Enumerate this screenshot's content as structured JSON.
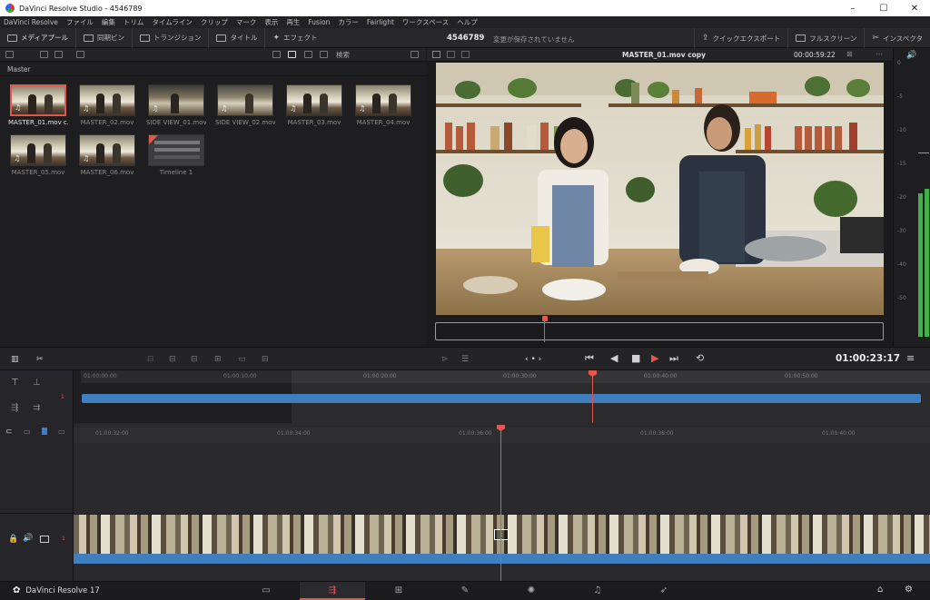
{
  "window": {
    "title": "DaVinci Resolve Studio - 4546789",
    "controls": [
      "–",
      "☐",
      "✕"
    ]
  },
  "menu": [
    "DaVinci Resolve",
    "ファイル",
    "編集",
    "トリム",
    "タイムライン",
    "クリップ",
    "マーク",
    "表示",
    "再生",
    "Fusion",
    "カラー",
    "Fairlight",
    "ワークスペース",
    "ヘルプ"
  ],
  "toolbar": {
    "media_pool": "メディアプール",
    "sync_bin": "同期ビン",
    "transitions": "トランジション",
    "titles": "タイトル",
    "effects": "エフェクト",
    "project_name": "4546789",
    "save_status": "変更が保存されていません",
    "quick_export": "クイックエクスポート",
    "fullscreen": "フルスクリーン",
    "inspector": "インスペクタ"
  },
  "media_pool": {
    "search": "検索",
    "bin": "Master",
    "clips": [
      {
        "name": "MASTER_01.mov c...",
        "selected": true,
        "type": "clip"
      },
      {
        "name": "MASTER_02.mov",
        "selected": false,
        "type": "clip"
      },
      {
        "name": "SIDE VIEW_01.mov",
        "selected": false,
        "type": "clip"
      },
      {
        "name": "SIDE VIEW_02.mov",
        "selected": false,
        "type": "clip"
      },
      {
        "name": "MASTER_03.mov",
        "selected": false,
        "type": "clip"
      },
      {
        "name": "MASTER_04.mov",
        "selected": false,
        "type": "clip"
      },
      {
        "name": "MASTER_05.mov",
        "selected": false,
        "type": "clip"
      },
      {
        "name": "MASTER_06.mov",
        "selected": false,
        "type": "clip"
      },
      {
        "name": "Timeline 1",
        "selected": false,
        "type": "timeline"
      }
    ]
  },
  "viewer": {
    "clip_name": "MASTER_01.mov copy",
    "source_timecode": "00:00:59:22",
    "timecode": "01:00:23:17"
  },
  "meter": {
    "scale": [
      "0",
      "-5",
      "-10",
      "-15",
      "-20",
      "-30",
      "-40",
      "-50"
    ]
  },
  "upper_timeline": {
    "ticks": [
      "01:00:00:00",
      "01:00:10:00",
      "01:00:20:00",
      "01:00:30:00",
      "01:00:40:00",
      "01:00:50:00"
    ]
  },
  "lower_timeline": {
    "ticks": [
      "01:00:32:00",
      "01:00:34:00",
      "01:00:36:00",
      "01:00:38:00",
      "01:00:40:00"
    ],
    "track_number": "1"
  },
  "pagebar": {
    "brand": "DaVinci Resolve 17",
    "pages": [
      "media",
      "cut",
      "edit",
      "fusion",
      "color",
      "fairlight",
      "deliver"
    ],
    "active": "cut"
  },
  "colors": {
    "accent": "#e4574c",
    "clip_blue": "#3f7fc0",
    "meter_green": "#3fb04a"
  }
}
